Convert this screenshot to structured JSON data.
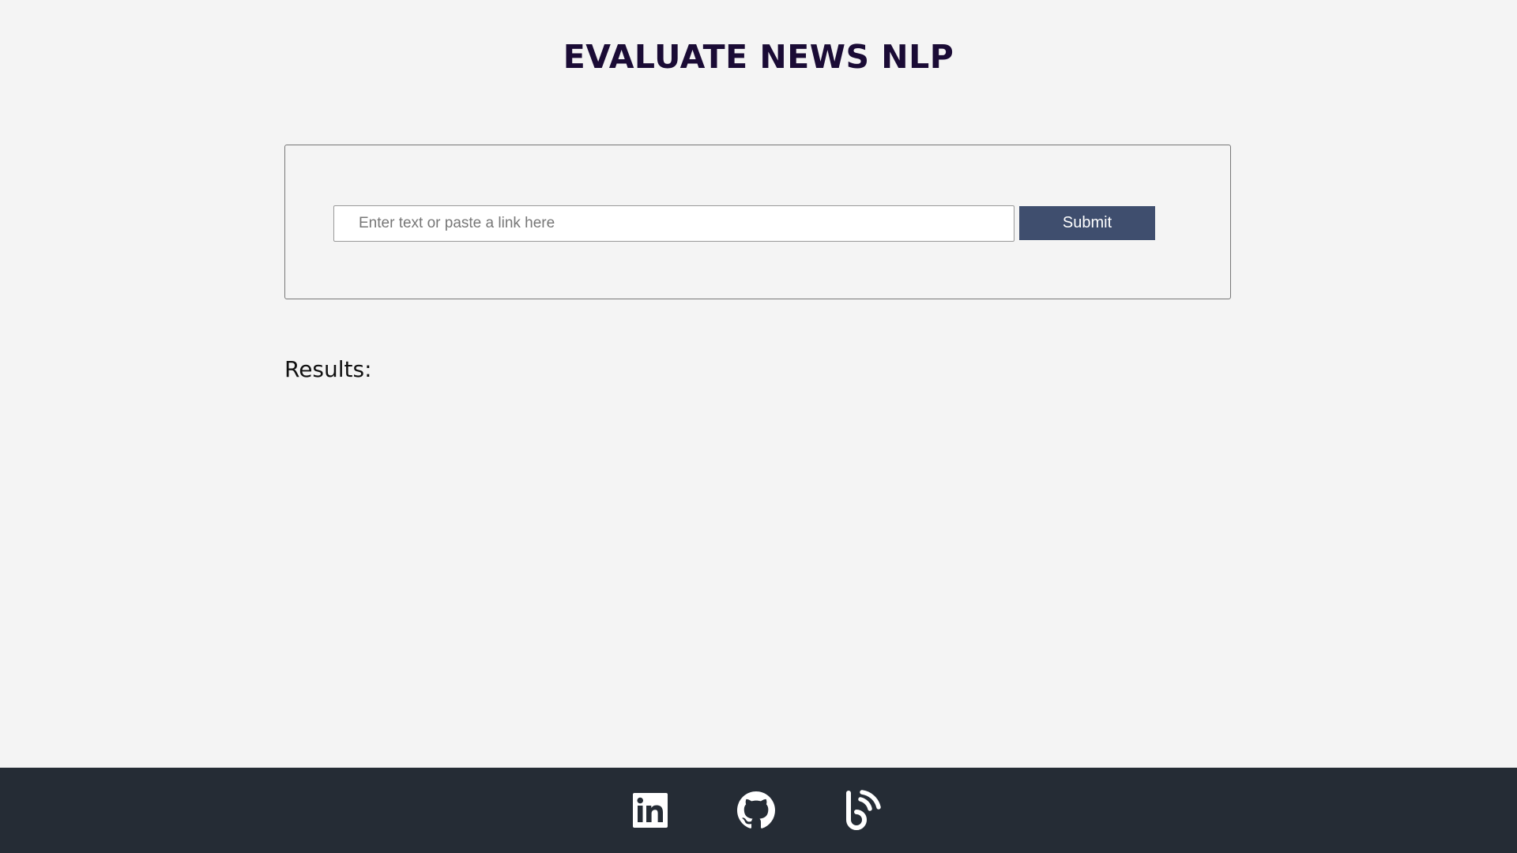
{
  "header": {
    "title": "EVALUATE NEWS NLP"
  },
  "form": {
    "input_placeholder": "Enter text or paste a link here",
    "input_value": "",
    "submit_label": "Submit"
  },
  "results": {
    "heading": "Results:",
    "content": ""
  },
  "footer": {
    "links": [
      {
        "icon": "linkedin-icon"
      },
      {
        "icon": "github-icon"
      },
      {
        "icon": "blog-icon"
      }
    ]
  },
  "colors": {
    "background": "#f4f4f4",
    "title": "#1a0b35",
    "button": "#3f4e6e",
    "footer": "#252c35",
    "footer_icons": "#ffffff"
  }
}
